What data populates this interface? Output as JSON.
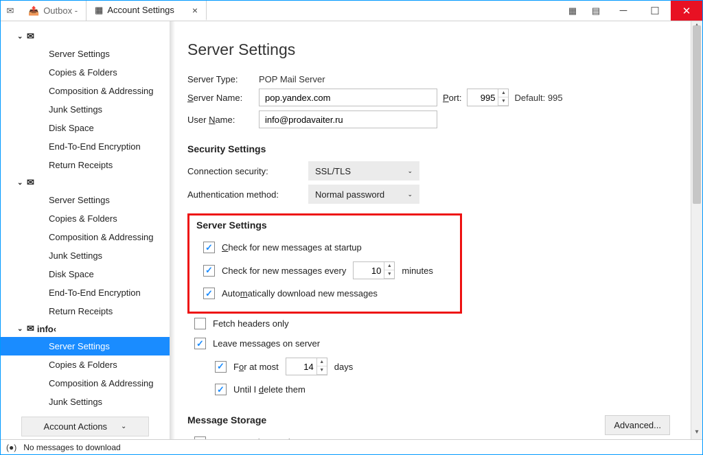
{
  "tabs": {
    "outbox": "Outbox -",
    "settings": "Account Settings"
  },
  "sidebar": {
    "accounts": [
      {
        "label": "",
        "items": [
          "Server Settings",
          "Copies & Folders",
          "Composition & Addressing",
          "Junk Settings",
          "Disk Space",
          "End-To-End Encryption",
          "Return Receipts"
        ]
      },
      {
        "label": "",
        "items": [
          "Server Settings",
          "Copies & Folders",
          "Composition & Addressing",
          "Junk Settings",
          "Disk Space",
          "End-To-End Encryption",
          "Return Receipts"
        ]
      },
      {
        "label": "info‹",
        "items": [
          "Server Settings",
          "Copies & Folders",
          "Composition & Addressing",
          "Junk Settings"
        ],
        "selected": 0
      }
    ],
    "account_actions": "Account Actions"
  },
  "page": {
    "title": "Server Settings",
    "server_type_label": "Server Type:",
    "server_type": "POP Mail Server",
    "server_name_label": "Server Name:",
    "server_name": "pop.yandex.com",
    "port_label": "Port:",
    "port": "995",
    "default_port": "Default: 995",
    "user_name_label": "User Name:",
    "user_name": "info@prodavaiter.ru",
    "security_heading": "Security Settings",
    "conn_sec_label": "Connection security:",
    "conn_sec_value": "SSL/TLS",
    "auth_label": "Authentication method:",
    "auth_value": "Normal password",
    "server_settings_heading": "Server Settings",
    "check_startup": "Check for new messages at startup",
    "check_every_pre": "Check for new messages every",
    "check_every_value": "10",
    "check_every_post": "minutes",
    "auto_dl": "Automatically download new messages",
    "fetch_headers": "Fetch headers only",
    "leave_server": "Leave messages on server",
    "for_at_most_pre": "For at most",
    "for_at_most_value": "14",
    "for_at_most_post": "days",
    "until_delete": "Until I delete them",
    "msg_storage_heading": "Message Storage",
    "empty_trash": "Empty Trash on Exit",
    "advanced": "Advanced..."
  },
  "statusbar": {
    "msg": "No messages to download"
  }
}
